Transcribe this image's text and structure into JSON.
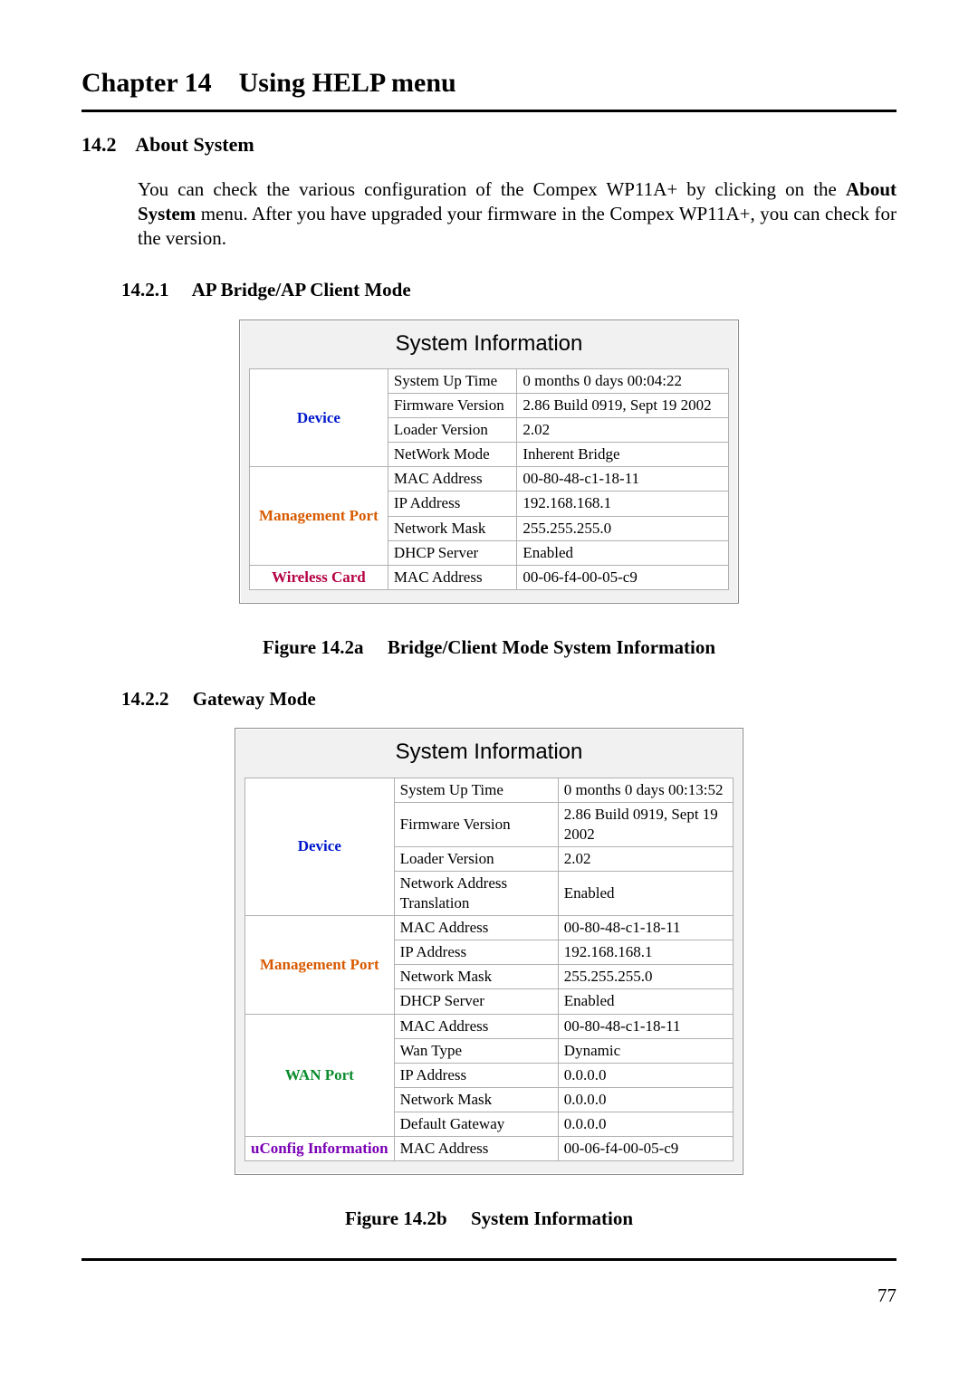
{
  "chapter": {
    "label": "Chapter 14",
    "title": "Using HELP menu"
  },
  "section": {
    "num": "14.2",
    "title": "About System"
  },
  "body": {
    "p1": "You can check the various configuration of the Compex WP11A+ by clicking on the ",
    "p1_bold": "About System",
    "p1b": " menu. After you have upgraded your firmware in the Compex WP11A+, you can check for the version."
  },
  "sub1": {
    "num": "14.2.1",
    "title": "AP Bridge/AP Client Mode"
  },
  "sub2": {
    "num": "14.2.2",
    "title": "Gateway Mode"
  },
  "fig1": {
    "num": "Figure 14.2a",
    "title": "Bridge/Client Mode System Information"
  },
  "fig2": {
    "num": "Figure 14.2b",
    "title": "System Information"
  },
  "panelTitle": "System Information",
  "labels": {
    "device": "Device",
    "mgmt": "Management Port",
    "wcard": "Wireless Card",
    "wan": "WAN Port",
    "uconf": "uConfig Information",
    "uptime": "System Up Time",
    "fw": "Firmware Version",
    "loader": "Loader Version",
    "netmode": "NetWork Mode",
    "nat": "Network Address Translation",
    "mac": "MAC Address",
    "ip": "IP Address",
    "mask": "Network Mask",
    "dhcp": "DHCP Server",
    "wantype": "Wan Type",
    "defgw": "Default Gateway"
  },
  "bridge": {
    "uptime": "0 months 0 days 00:04:22",
    "fw": "2.86 Build 0919, Sept 19 2002",
    "loader": "2.02",
    "netmode": "Inherent Bridge",
    "mgmt_mac": "00-80-48-c1-18-11",
    "mgmt_ip": "192.168.168.1",
    "mgmt_mask": "255.255.255.0",
    "mgmt_dhcp": "Enabled",
    "wcard_mac": "00-06-f4-00-05-c9"
  },
  "gateway": {
    "uptime": "0 months 0 days 00:13:52",
    "fw": "2.86 Build 0919, Sept 19 2002",
    "loader": "2.02",
    "nat": "Enabled",
    "mgmt_mac": "00-80-48-c1-18-11",
    "mgmt_ip": "192.168.168.1",
    "mgmt_mask": "255.255.255.0",
    "mgmt_dhcp": "Enabled",
    "wan_mac": "00-80-48-c1-18-11",
    "wan_type": "Dynamic",
    "wan_ip": "0.0.0.0",
    "wan_mask": "0.0.0.0",
    "wan_gw": "0.0.0.0",
    "uconf_mac": "00-06-f4-00-05-c9"
  },
  "page": "77"
}
